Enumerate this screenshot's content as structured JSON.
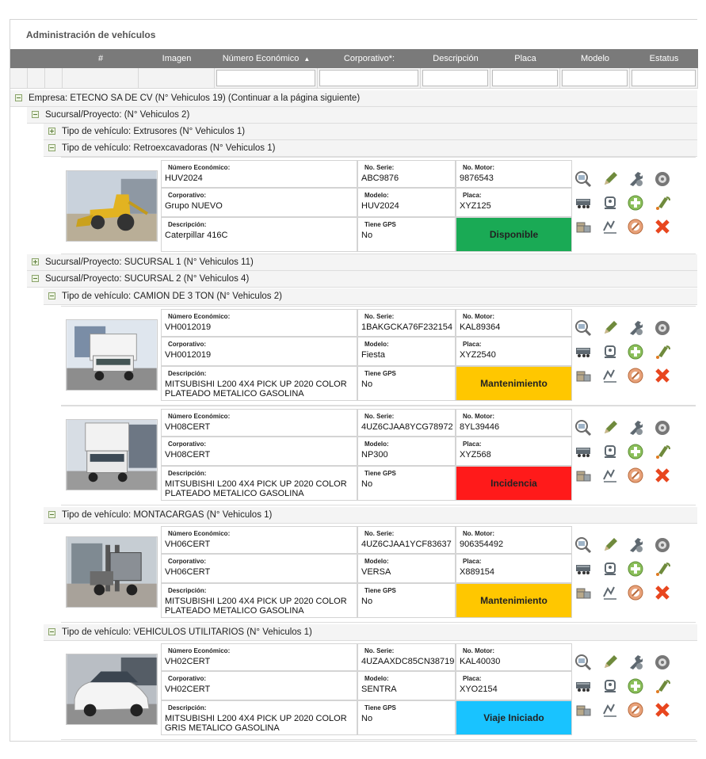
{
  "page": {
    "title": "Administración de vehículos"
  },
  "columns": [
    "#",
    "Imagen",
    "Número Económico",
    "Corporativo*:",
    "Descripción",
    "Placa",
    "Modelo",
    "Estatus"
  ],
  "sort_indicator": "▲",
  "company": "Empresa: ETECNO SA DE CV (N° Vehiculos 19) (Continuar a la página siguiente)",
  "branch_1": "Sucursal/Proyecto: (N° Vehiculos 2)",
  "type_extrusores": "Tipo de vehículo: Extrusores (N° Vehiculos 1)",
  "type_retro": "Tipo de vehículo: Retroexcavadoras (N° Vehiculos 1)",
  "branch_2": "Sucursal/Proyecto: SUCURSAL 1 (N° Vehiculos 11)",
  "branch_3": "Sucursal/Proyecto: SUCURSAL 2 (N° Vehiculos 4)",
  "type_camion": "Tipo de vehículo: CAMION DE 3 TON (N° Vehiculos 2)",
  "type_monta": "Tipo de vehículo: MONTACARGAS (N° Vehiculos 1)",
  "type_util": "Tipo de vehículo: VEHICULOS UTILITARIOS (N° Vehiculos 1)",
  "labels": {
    "numero": "Número Económico:",
    "serie": "No. Serie:",
    "motor": "No. Motor:",
    "corporativo": "Corporativo:",
    "modelo": "Modelo:",
    "placa": "Placa:",
    "descripcion": "Descripción:",
    "gps": "Tiene GPS"
  },
  "vehicles": [
    {
      "numero": "HUV2024",
      "serie": "ABC9876",
      "motor": "9876543",
      "corporativo": "Grupo NUEVO",
      "modelo": "HUV2024",
      "placa": "XYZ125",
      "descripcion": "Caterpillar 416C",
      "gps": "No",
      "status": "Disponible",
      "status_color": "#1aaa55"
    },
    {
      "numero": "VH0012019",
      "serie": "1BAKGCKA76F232154",
      "motor": "KAL89364",
      "corporativo": "VH0012019",
      "modelo": "Fiesta",
      "placa": "XYZ2540",
      "descripcion": "MITSUBISHI L200 4X4 PICK UP 2020 COLOR PLATEADO METALICO GASOLINA",
      "gps": "No",
      "status": "Mantenimiento",
      "status_color": "#ffc700"
    },
    {
      "numero": "VH08CERT",
      "serie": "4UZ6CJAA8YCG78972",
      "motor": "8YL39446",
      "corporativo": "VH08CERT",
      "modelo": "NP300",
      "placa": "XYZ568",
      "descripcion": "MITSUBISHI L200 4X4 PICK UP 2020 COLOR PLATEADO METALICO GASOLINA",
      "gps": "No",
      "status": "Incidencia",
      "status_color": "#ff1a1a"
    },
    {
      "numero": "VH06CERT",
      "serie": "4UZ6CJAA1YCF83637",
      "motor": "906354492",
      "corporativo": "VH06CERT",
      "modelo": "VERSA",
      "placa": "X889154",
      "descripcion": "MITSUBISHI L200 4X4 PICK UP 2020 COLOR PLATEADO METALICO GASOLINA",
      "gps": "No",
      "status": "Mantenimiento",
      "status_color": "#ffc700"
    },
    {
      "numero": "VH02CERT",
      "serie": "4UZAAXDC85CN38719",
      "motor": "KAL40030",
      "corporativo": "VH02CERT",
      "modelo": "SENTRA",
      "placa": "XYO2154",
      "descripcion": "MITSUBISHI L200 4X4 PICK UP 2020 COLOR GRIS METALICO GASOLINA",
      "gps": "No",
      "status": "Viaje Iniciado",
      "status_color": "#19c3ff"
    }
  ]
}
